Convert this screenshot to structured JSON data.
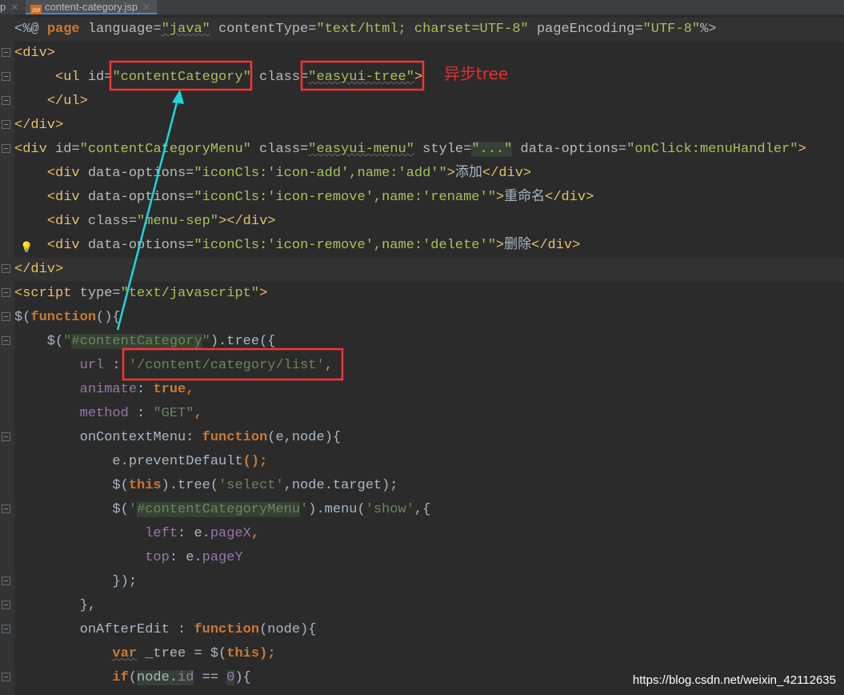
{
  "tabs": [
    {
      "label": "p",
      "active": false
    },
    {
      "label": "content-category.jsp",
      "active": true,
      "file_badge": "JSP"
    }
  ],
  "annotation": {
    "label": "异步tree",
    "color": "#e03030"
  },
  "watermark": "https://blog.csdn.net/weixin_42112635",
  "colors": {
    "background": "#2b2b2b",
    "tag": "#e8bf6a",
    "string": "#a5c25c",
    "keyword": "#cc7832",
    "property": "#9876aa",
    "highlight_box": "#ff3333",
    "arrow": "#1ad7e0"
  },
  "code_lines": [
    [
      [
        "<%@ ",
        "d"
      ],
      [
        "page",
        "k"
      ],
      [
        " language=",
        "a"
      ],
      [
        "\"java\"",
        "s u"
      ],
      [
        " contentType=",
        "a"
      ],
      [
        "\"text/html; charset=UTF-8\"",
        "s"
      ],
      [
        " pageEncoding=",
        "a"
      ],
      [
        "\"UTF-8\"",
        "s"
      ],
      [
        "%>",
        "d"
      ]
    ],
    [
      [
        "<div>",
        "t"
      ]
    ],
    [
      [
        "     ",
        "d"
      ],
      [
        "<ul ",
        "t"
      ],
      [
        "id=",
        "a"
      ],
      [
        "\"contentCategory\"",
        "s"
      ],
      [
        " class=",
        "a"
      ],
      [
        "\"easyui-tree\"",
        "s u"
      ],
      [
        ">",
        "t"
      ]
    ],
    [
      [
        "    ",
        "d"
      ],
      [
        "</ul>",
        "t"
      ]
    ],
    [
      [
        "</div>",
        "t"
      ]
    ],
    [
      [
        "<div ",
        "t"
      ],
      [
        "id=",
        "a"
      ],
      [
        "\"contentCategoryMenu\"",
        "s"
      ],
      [
        " class=",
        "a"
      ],
      [
        "\"easyui-menu\"",
        "s u"
      ],
      [
        " style=",
        "a"
      ],
      [
        "\"...\"",
        "s mark"
      ],
      [
        " data-options=",
        "a"
      ],
      [
        "\"onClick:menuHandler\"",
        "s"
      ],
      [
        ">",
        "t"
      ]
    ],
    [
      [
        "    ",
        "d"
      ],
      [
        "<div ",
        "t"
      ],
      [
        "data-options=",
        "a"
      ],
      [
        "\"iconCls:'icon-add',name:'add'\"",
        "s"
      ],
      [
        ">",
        "t"
      ],
      [
        "添加",
        "d"
      ],
      [
        "</div>",
        "t"
      ]
    ],
    [
      [
        "    ",
        "d"
      ],
      [
        "<div ",
        "t"
      ],
      [
        "data-options=",
        "a"
      ],
      [
        "\"iconCls:'icon-remove',name:'rename'\"",
        "s"
      ],
      [
        ">",
        "t"
      ],
      [
        "重命名",
        "d"
      ],
      [
        "</div>",
        "t"
      ]
    ],
    [
      [
        "    ",
        "d"
      ],
      [
        "<div ",
        "t"
      ],
      [
        "class=",
        "a"
      ],
      [
        "\"menu-sep\"",
        "s"
      ],
      [
        "></div>",
        "t"
      ]
    ],
    [
      [
        "    ",
        "d"
      ],
      [
        "<div ",
        "t"
      ],
      [
        "data-options=",
        "a"
      ],
      [
        "\"iconCls:'icon-remove',name:'delete'\"",
        "s"
      ],
      [
        ">",
        "t"
      ],
      [
        "删除",
        "d"
      ],
      [
        "</div>",
        "t"
      ]
    ],
    [
      [
        "</div>",
        "t"
      ]
    ],
    [
      [
        "<script ",
        "t"
      ],
      [
        "type=",
        "a"
      ],
      [
        "\"text/javascript\"",
        "s"
      ],
      [
        ">",
        "t"
      ]
    ],
    [
      [
        "$(",
        "d"
      ],
      [
        "function",
        "k"
      ],
      [
        "(){",
        "d"
      ]
    ],
    [
      [
        "    $(",
        "d"
      ],
      [
        "\"",
        "js"
      ],
      [
        "#contentCategory",
        "js mark"
      ],
      [
        "\"",
        "js"
      ],
      [
        ").tree({",
        "d"
      ]
    ],
    [
      [
        "        ",
        "d"
      ],
      [
        "url",
        "p"
      ],
      [
        " : ",
        "d"
      ],
      [
        "'/content/category/list'",
        "js"
      ],
      [
        ",",
        "k"
      ]
    ],
    [
      [
        "        ",
        "d"
      ],
      [
        "animate",
        "p"
      ],
      [
        ": ",
        "d"
      ],
      [
        "true",
        "k"
      ],
      [
        ",",
        "k"
      ]
    ],
    [
      [
        "        ",
        "d"
      ],
      [
        "method",
        "p"
      ],
      [
        " : ",
        "d"
      ],
      [
        "\"GET\"",
        "js"
      ],
      [
        ",",
        "k"
      ]
    ],
    [
      [
        "        ",
        "d"
      ],
      [
        "onContextMenu",
        "d"
      ],
      [
        ": ",
        "d"
      ],
      [
        "function",
        "k"
      ],
      [
        "(e,node){",
        "d"
      ]
    ],
    [
      [
        "            e.",
        "d"
      ],
      [
        "preventDefault",
        "d"
      ],
      [
        "();",
        "k"
      ]
    ],
    [
      [
        "            $(",
        "d"
      ],
      [
        "this",
        "k"
      ],
      [
        ").tree(",
        "d"
      ],
      [
        "'select'",
        "js"
      ],
      [
        ",node.target);",
        "d"
      ]
    ],
    [
      [
        "            $(",
        "d"
      ],
      [
        "'",
        "js"
      ],
      [
        "#contentCategoryMenu",
        "js mark"
      ],
      [
        "'",
        "js"
      ],
      [
        ").menu(",
        "d"
      ],
      [
        "'show'",
        "js"
      ],
      [
        ",{",
        "d"
      ]
    ],
    [
      [
        "                ",
        "d"
      ],
      [
        "left",
        "p"
      ],
      [
        ": e.",
        "d"
      ],
      [
        "pageX",
        "p"
      ],
      [
        ",",
        "k"
      ]
    ],
    [
      [
        "                ",
        "d"
      ],
      [
        "top",
        "p"
      ],
      [
        ": e.",
        "d"
      ],
      [
        "pageY",
        "p"
      ]
    ],
    [
      [
        "            });",
        "d"
      ]
    ],
    [
      [
        "        },",
        "d"
      ]
    ],
    [
      [
        "        ",
        "d"
      ],
      [
        "onAfterEdit",
        "d"
      ],
      [
        " : ",
        "d"
      ],
      [
        "function",
        "k"
      ],
      [
        "(node){",
        "d"
      ]
    ],
    [
      [
        "            ",
        "d"
      ],
      [
        "var",
        "k u"
      ],
      [
        " _tree = $(",
        "d"
      ],
      [
        "this",
        "k"
      ],
      [
        ");",
        "k"
      ]
    ],
    [
      [
        "            ",
        "d"
      ],
      [
        "if",
        "k"
      ],
      [
        "(",
        "d"
      ],
      [
        "node.",
        "d mark"
      ],
      [
        "id",
        "p mark"
      ],
      [
        " == ",
        "d"
      ],
      [
        "0",
        "p mark"
      ],
      [
        "){",
        "d"
      ]
    ]
  ]
}
